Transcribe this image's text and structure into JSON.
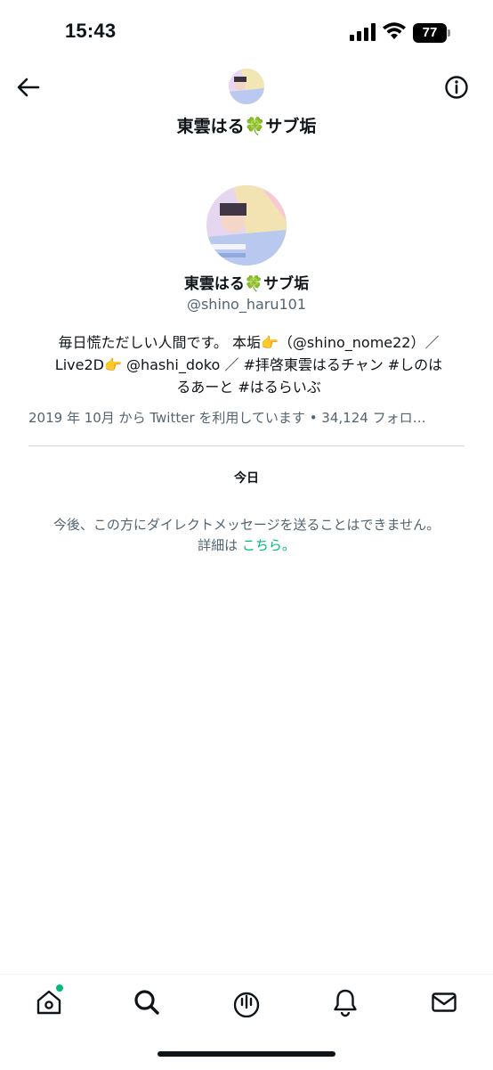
{
  "status_bar": {
    "time": "15:43",
    "battery": "77"
  },
  "header": {
    "title": "東雲はる🍀サブ垢",
    "back_icon": "arrow-left-icon",
    "info_icon": "info-circle-icon"
  },
  "profile": {
    "display_name": "東雲はる🍀サブ垢",
    "handle": "@shino_haru101",
    "bio_line1": "毎日慌ただしい人間です。 本垢👉（@shino_nome22）／",
    "bio_line2": "Live2D👉 @hashi_doko ／ #拝啓東雲はるチャン #しのは",
    "bio_line3": "るあーと #はるらいぶ",
    "meta": "2019 年 10月 から Twitter を利用しています • 34,124 フォロ…"
  },
  "conversation": {
    "date_label": "今日",
    "notice_line1": "今後、この方にダイレクトメッセージを送ることはできません。",
    "notice_prefix": "詳細は ",
    "notice_link": "こちら。"
  },
  "tabbar": {
    "items": [
      "home-icon",
      "search-icon",
      "spaces-icon",
      "notifications-icon",
      "messages-icon"
    ]
  },
  "colors": {
    "accent": "#00ba7c",
    "text": "#0f1419",
    "secondary": "#536471"
  }
}
